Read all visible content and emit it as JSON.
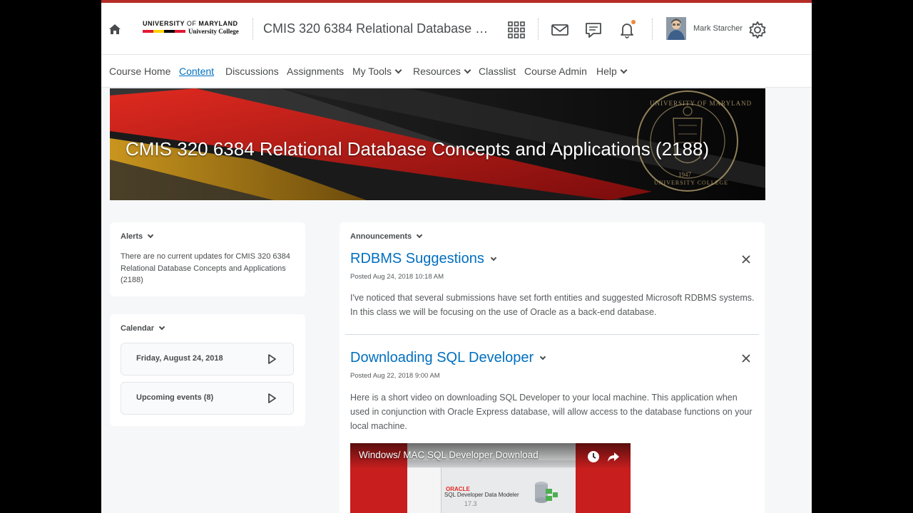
{
  "header": {
    "logo_line1_a": "UNIVERSITY",
    "logo_line1_of": "OF",
    "logo_line1_b": "MARYLAND",
    "logo_line2": "University College",
    "logo_colors": [
      "#e21833",
      "#ffd200",
      "#000000",
      "#e21833"
    ],
    "course_title": "CMIS 320 6384 Relational Database …",
    "user_name": "Mark Starcher",
    "notification_dot_color": "#f0863a",
    "icons": [
      "home-icon",
      "waffle-grid-icon",
      "mail-icon",
      "chat-icon",
      "bell-icon",
      "gear-icon"
    ]
  },
  "nav": {
    "items": [
      {
        "label": "Course Home",
        "active": false
      },
      {
        "label": "Content",
        "active": true
      },
      {
        "label": "Discussions",
        "active": false
      },
      {
        "label": "Assignments",
        "active": false
      },
      {
        "label": "My Tools",
        "active": false
      },
      {
        "label": "Resources",
        "active": false
      },
      {
        "label": "Classlist",
        "active": false
      },
      {
        "label": "Course Admin",
        "active": false
      },
      {
        "label": "Help",
        "active": false
      }
    ],
    "accent_color": "#006fbf"
  },
  "banner": {
    "title": "CMIS 320 6384 Relational Database Concepts and Applications (2188)",
    "seal_text_top": "UNIVERSITY OF MARYLAND",
    "seal_text_bottom": "UNIVERSITY COLLEGE",
    "seal_year": "1947"
  },
  "alerts": {
    "heading": "Alerts",
    "text": "There are no current updates for CMIS 320 6384 Relational Database Concepts and Applications (2188)"
  },
  "calendar": {
    "heading": "Calendar",
    "rows": [
      {
        "label": "Friday, August 24, 2018"
      },
      {
        "label": "Upcoming events (8)"
      }
    ]
  },
  "announcements": {
    "heading": "Announcements",
    "items": [
      {
        "title": "RDBMS Suggestions",
        "posted": "Posted Aug 24, 2018 10:18 AM",
        "body": "I've noticed that several submissions have set forth entities and suggested Microsoft RDBMS systems. In this class we will be focusing on the use of Oracle as a back-end database."
      },
      {
        "title": "Downloading SQL Developer",
        "posted": "Posted Aug 22, 2018 9:00 AM",
        "body": "Here is a short video on downloading SQL Developer to your local machine. This application when used in conjunction with Oracle Express database, will allow access to the database functions on your local machine."
      }
    ],
    "video": {
      "title": "Windows/ MAC SQL Developer Download",
      "oracle_label": "ORACLE",
      "product_label": "SQL Developer Data Modeler",
      "version": "17.3"
    }
  }
}
